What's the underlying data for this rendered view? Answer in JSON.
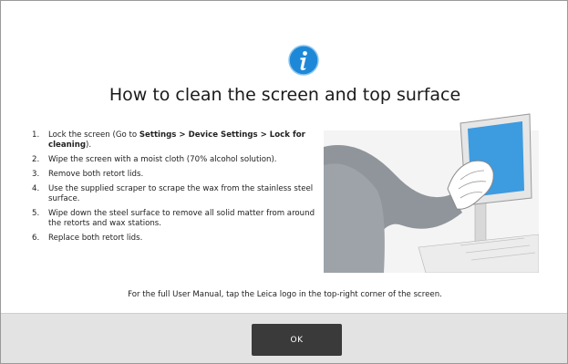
{
  "dialog": {
    "icon": "info-icon",
    "title": "How to clean the screen and top surface",
    "steps": [
      {
        "num": "1.",
        "pre": "Lock the screen (Go to ",
        "b1": "Settings",
        "mid1": " > ",
        "b2": "Device Settings",
        "mid2": " > ",
        "b3": "Lock for cleaning",
        "post": ")."
      },
      {
        "num": "2.",
        "text": "Wipe the screen with a moist cloth (70% alcohol solution)."
      },
      {
        "num": "3.",
        "text": "Remove both retort lids."
      },
      {
        "num": "4.",
        "text": "Use the supplied scraper to scrape the wax from the stainless steel surface."
      },
      {
        "num": "5.",
        "text": "Wipe down the steel surface to remove all solid matter from around the retorts and wax stations."
      },
      {
        "num": "6.",
        "text": "Replace both retort lids."
      }
    ],
    "manual_note": "For the full User Manual, tap the Leica logo in the top-right corner of the screen.",
    "ok_label": "OK",
    "colors": {
      "icon_blue": "#1e88d8",
      "screen_blue": "#3d9be0",
      "button_dark": "#3a3a3a",
      "footer_gray": "#e3e3e3"
    }
  }
}
